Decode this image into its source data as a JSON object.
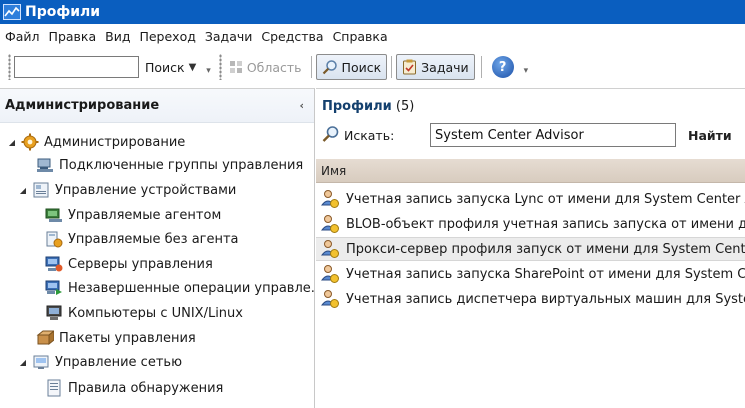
{
  "window": {
    "title": "Профили"
  },
  "menu": [
    "Файл",
    "Правка",
    "Вид",
    "Переход",
    "Задачи",
    "Средства",
    "Справка"
  ],
  "toolbar": {
    "search_value": "",
    "search_label": "Поиск",
    "scope_label": "Область",
    "find_label": "Поиск",
    "tasks_label": "Задачи"
  },
  "left_panel": {
    "title": "Администрирование",
    "items": [
      {
        "label": "Администрирование",
        "icon": "gear-icon",
        "expander": "expanded"
      },
      {
        "label": "Подключенные группы управления",
        "icon": "connected-groups-icon",
        "expander": ""
      },
      {
        "label": "Управление устройствами",
        "icon": "device-management-icon",
        "expander": "expanded"
      },
      {
        "label": "Управляемые агентом",
        "icon": "agent-managed-icon",
        "expander": ""
      },
      {
        "label": "Управляемые без агента",
        "icon": "agentless-icon",
        "expander": ""
      },
      {
        "label": "Серверы управления",
        "icon": "management-servers-icon",
        "expander": ""
      },
      {
        "label": "Незавершенные операции управле...",
        "icon": "pending-management-icon",
        "expander": ""
      },
      {
        "label": "Компьютеры с UNIX/Linux",
        "icon": "unix-computer-icon",
        "expander": ""
      },
      {
        "label": "Пакеты управления",
        "icon": "management-packs-icon",
        "expander": ""
      },
      {
        "label": "Управление сетью",
        "icon": "network-management-icon",
        "expander": "expanded"
      },
      {
        "label": "Правила обнаружения",
        "icon": "discovery-rules-icon",
        "expander": ""
      }
    ]
  },
  "right_panel": {
    "title": "Профили",
    "count": "(5)",
    "search_label": "Искать:",
    "search_value": "System Center Advisor",
    "find_label": "Найти",
    "column_name": "Имя",
    "rows": [
      "Учетная запись запуска Lync от имени для System Center Advisor",
      "BLOB-объект профиля учетная запись запуска от имени для System Center Advisor",
      "Прокси-сервер профиля запуск от имени для System Center Advisor",
      "Учетная запись запуска SharePoint от имени для System Center Advisor",
      "Учетная запись диспетчера виртуальных машин для System Center Advisor"
    ]
  }
}
